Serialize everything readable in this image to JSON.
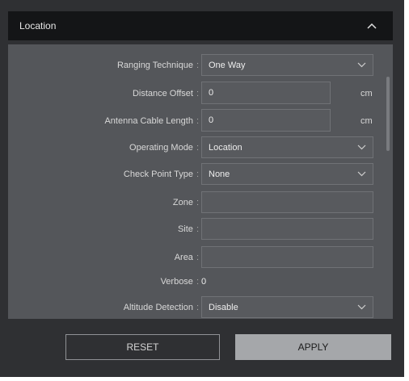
{
  "header": {
    "title": "Location"
  },
  "fields": {
    "ranging_technique": {
      "label": "Ranging Technique",
      "value": "One Way"
    },
    "distance_offset": {
      "label": "Distance Offset",
      "value": "0",
      "unit": "cm"
    },
    "antenna_cable_length": {
      "label": "Antenna Cable Length",
      "value": "0",
      "unit": "cm"
    },
    "operating_mode": {
      "label": "Operating Mode",
      "value": "Location"
    },
    "check_point_type": {
      "label": "Check Point Type",
      "value": "None"
    },
    "zone": {
      "label": "Zone",
      "value": ""
    },
    "site": {
      "label": "Site",
      "value": ""
    },
    "area": {
      "label": "Area",
      "value": ""
    },
    "verbose": {
      "label": "Verbose",
      "value": "0"
    },
    "altitude_detection": {
      "label": "Altitude Detection",
      "value": "Disable"
    }
  },
  "colon": ":",
  "buttons": {
    "reset": "RESET",
    "apply": "APPLY"
  },
  "icons": {
    "collapse": "chevron-up-icon",
    "dropdown": "chevron-down-icon"
  },
  "colors": {
    "panel_bg": "#2f3033",
    "header_bg": "#141517",
    "content_bg": "#54565a",
    "apply_bg": "#a5a7aa"
  }
}
